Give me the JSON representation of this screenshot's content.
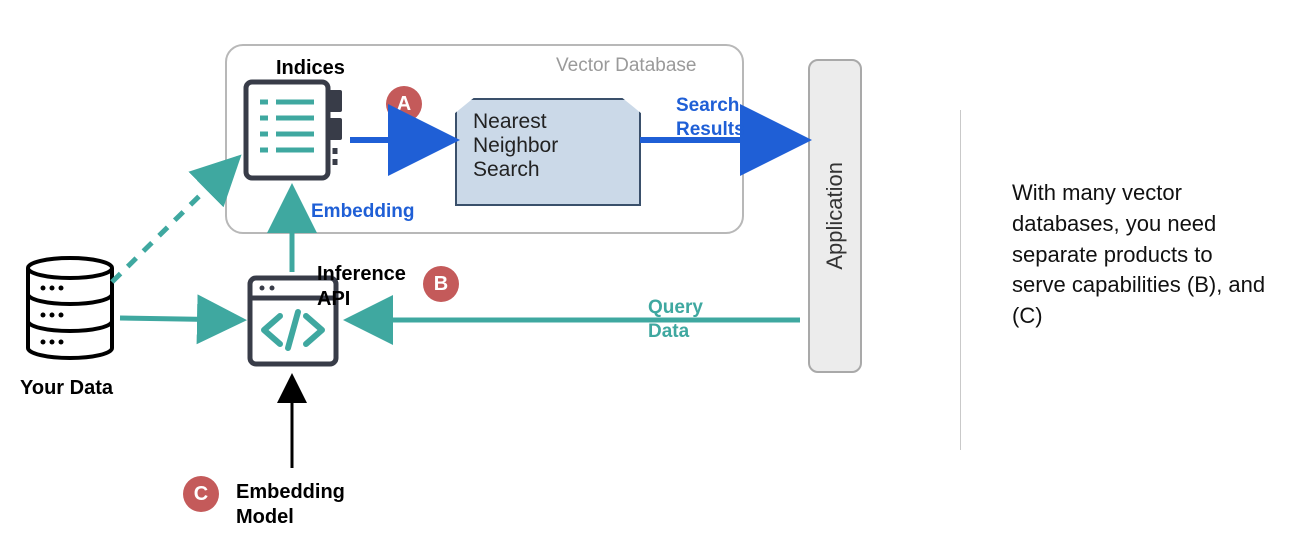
{
  "diagram": {
    "container_label": "Vector Database",
    "your_data": "Your Data",
    "indices": "Indices",
    "embedding": "Embedding",
    "nn_search": "Nearest\nNeighbor\nSearch",
    "search_results": "Search\nResults",
    "application": "Application",
    "inference_api": "Inference\nAPI",
    "query_data": "Query\nData",
    "embedding_model": "Embedding\nModel",
    "badge_a": "A",
    "badge_b": "B",
    "badge_c": "C"
  },
  "caption": "With many vector databases, you need separate products to serve capabilities (B), and (C)",
  "colors": {
    "teal": "#3fa8a0",
    "blue": "#1f5fd6",
    "dark": "#383c48",
    "badge": "#c45a5a",
    "nn_fill": "#cbd9e8",
    "nn_stroke": "#3a506b"
  }
}
